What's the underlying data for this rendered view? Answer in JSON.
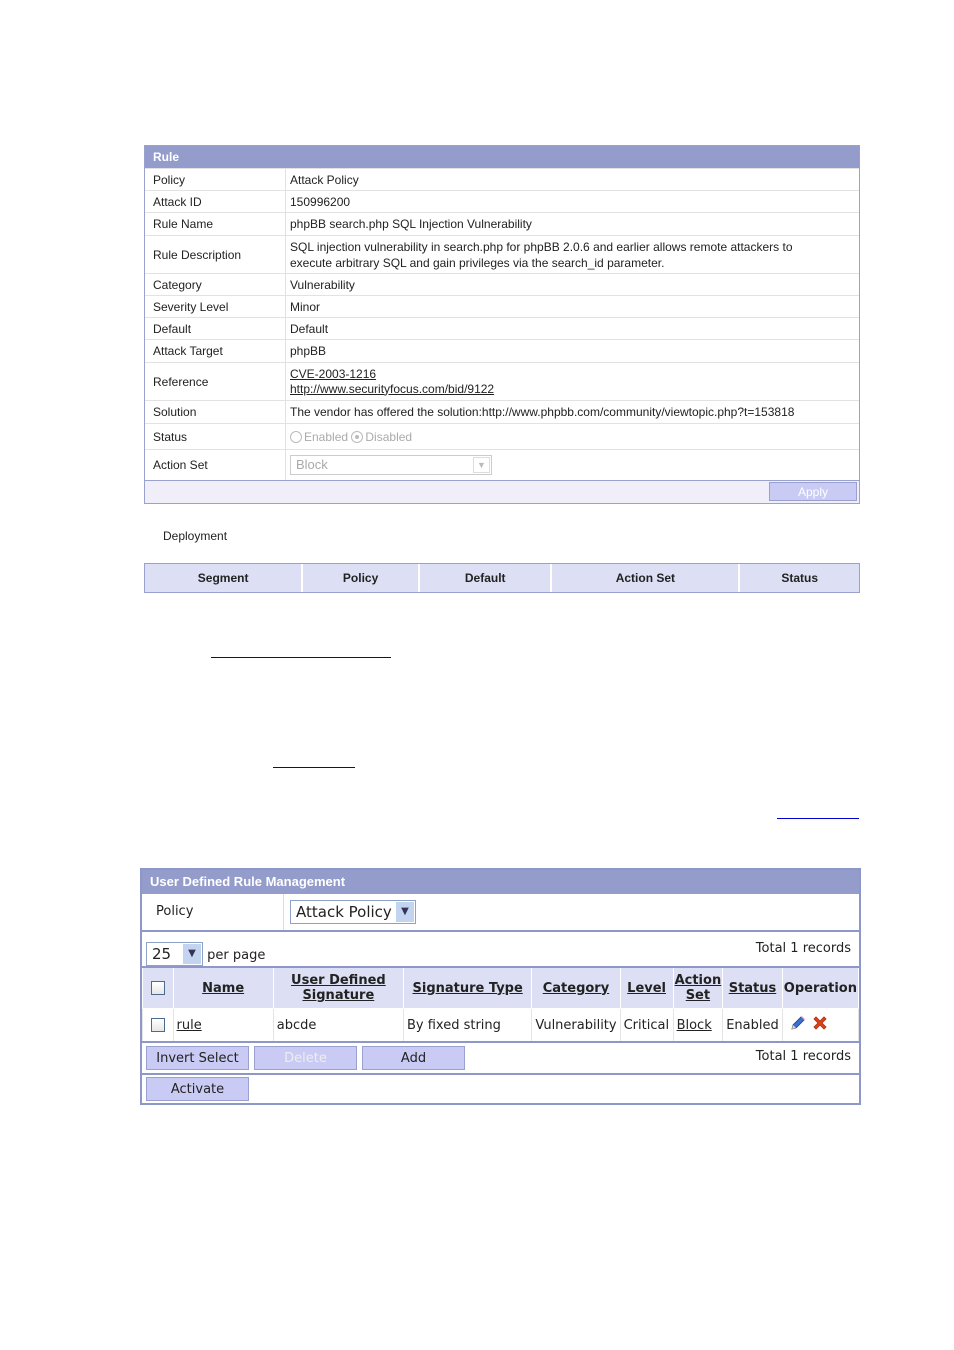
{
  "rule_panel": {
    "title": "Rule",
    "rows": {
      "policy": {
        "label": "Policy",
        "value": "Attack Policy"
      },
      "attack_id": {
        "label": "Attack ID",
        "value": "150996200"
      },
      "rule_name": {
        "label": "Rule Name",
        "value": "phpBB search.php SQL Injection Vulnerability"
      },
      "rule_description": {
        "label": "Rule Description",
        "value": "SQL injection vulnerability in search.php for phpBB 2.0.6 and earlier allows remote attackers to execute arbitrary SQL and gain privileges via the search_id parameter."
      },
      "category": {
        "label": "Category",
        "value": "Vulnerability"
      },
      "severity": {
        "label": "Severity Level",
        "value": "Minor"
      },
      "default": {
        "label": "Default",
        "value": "Default"
      },
      "attack_target": {
        "label": "Attack Target",
        "value": "phpBB"
      },
      "reference": {
        "label": "Reference",
        "links": [
          "CVE-2003-1216",
          "http://www.securityfocus.com/bid/9122"
        ]
      },
      "solution": {
        "label": "Solution",
        "value": "The vendor has offered the solution:http://www.phpbb.com/community/viewtopic.php?t=153818"
      },
      "status": {
        "label": "Status",
        "options": [
          "Enabled",
          "Disabled"
        ],
        "selected": "Disabled"
      },
      "action_set": {
        "label": "Action Set",
        "value": "Block"
      }
    },
    "apply_label": "Apply"
  },
  "deployment": {
    "label": "Deployment",
    "columns": [
      "Segment",
      "Policy",
      "Default",
      "Action Set",
      "Status"
    ]
  },
  "udr_panel": {
    "title": "User Defined Rule Management",
    "policy_label": "Policy",
    "policy_value": "Attack Policy",
    "per_page_value": "25",
    "per_page_label": "per page",
    "total_records": "Total 1 records",
    "columns": [
      "Name",
      "User Defined Signature",
      "Signature Type",
      "Category",
      "Level",
      "Action Set",
      "Status",
      "Operation"
    ],
    "rows": [
      {
        "name": "rule",
        "signature": "abcde",
        "signature_type": "By fixed string",
        "category": "Vulnerability",
        "level": "Critical",
        "action_set": "Block",
        "status": "Enabled"
      }
    ],
    "buttons": {
      "invert_select": "Invert Select",
      "delete": "Delete",
      "add": "Add",
      "activate": "Activate"
    }
  }
}
